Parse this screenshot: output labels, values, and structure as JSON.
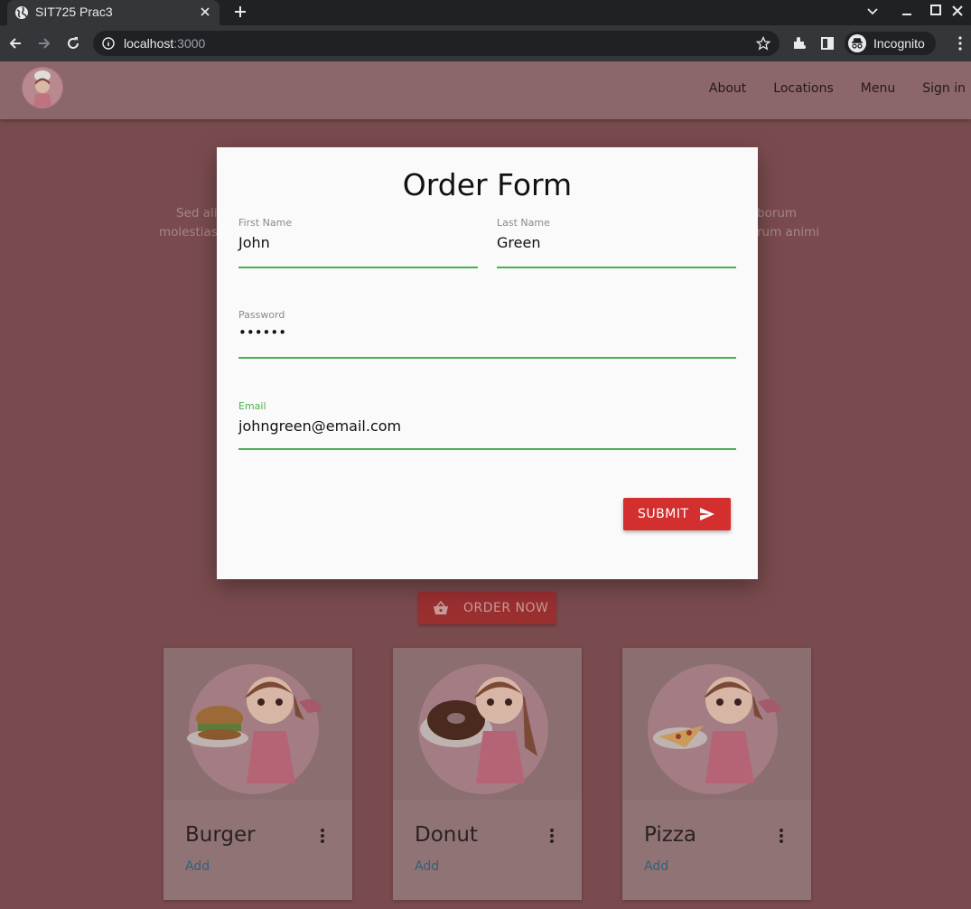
{
  "browser": {
    "tab_title": "SIT725 Prac3",
    "url_host": "localhost",
    "url_port": ":3000",
    "profile_label": "Incognito"
  },
  "nav": {
    "links": [
      "About",
      "Locations",
      "Menu",
      "Sign in"
    ]
  },
  "background": {
    "text_fragments": [
      "Sed ali",
      "molestias",
      "borum",
      "rum animi"
    ],
    "order_button": "ORDER NOW"
  },
  "cards": [
    {
      "name": "Burger",
      "action": "Add"
    },
    {
      "name": "Donut",
      "action": "Add"
    },
    {
      "name": "Pizza",
      "action": "Add"
    }
  ],
  "modal": {
    "title": "Order Form",
    "first_name": {
      "label": "First Name",
      "value": "John"
    },
    "last_name": {
      "label": "Last Name",
      "value": "Green"
    },
    "password": {
      "label": "Password",
      "value": "••••••"
    },
    "email": {
      "label": "Email",
      "value": "johngreen@email.com"
    },
    "submit_label": "SUBMIT"
  },
  "colors": {
    "accent_green": "#4caf50",
    "submit_red": "#d32f2f",
    "overlay": "#7a4b4e"
  }
}
